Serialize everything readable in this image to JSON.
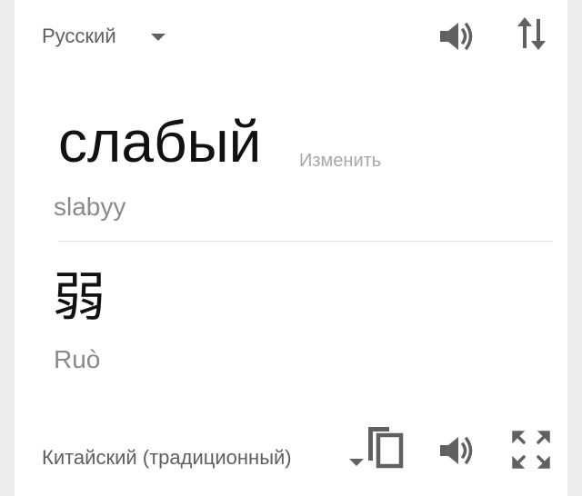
{
  "source": {
    "language": "Русский",
    "word": "слабый",
    "edit_label": "Изменить",
    "transliteration": "slabyy"
  },
  "target": {
    "language": "Китайский (традиционный)",
    "word": "弱",
    "transliteration": "Ruò"
  },
  "icons": {
    "source_speaker": "speaker-icon",
    "swap": "swap-languages-icon",
    "copy": "copy-icon",
    "target_speaker": "speaker-icon",
    "fullscreen": "fullscreen-icon"
  },
  "colors": {
    "icon": "#616161",
    "text_primary": "#111111",
    "text_secondary": "#8a8a8a",
    "background": "#ffffff"
  }
}
